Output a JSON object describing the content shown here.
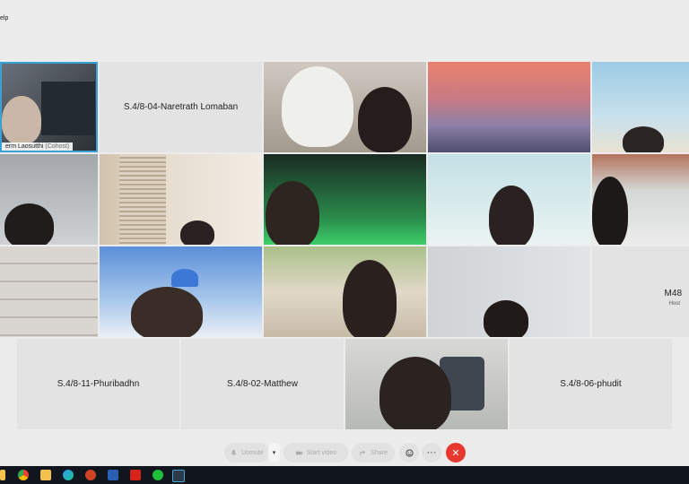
{
  "menu": {
    "help_label": "elp"
  },
  "participants": {
    "p1": {
      "name": "erm Laosutthi",
      "role": "(Cohost)"
    },
    "p2": {
      "name": "S.4/8-04-Naretrath Lomaban"
    },
    "host": {
      "name": "M48",
      "role": "Host"
    },
    "p17": {
      "name": "S.4/8-11-Phuribadhn"
    },
    "p18": {
      "name": "S.4/8-02-Matthew"
    },
    "p20": {
      "name": "S.4/8-06-phudit"
    }
  },
  "controls": {
    "unmute_label": "Unmute",
    "start_video_label": "Start video",
    "share_label": "Share",
    "more_label": "···",
    "end_label": "✕"
  },
  "colors": {
    "active_speaker_border": "#3aa0d8",
    "end_button": "#e8372e",
    "tile_background": "#e3e3e3"
  }
}
